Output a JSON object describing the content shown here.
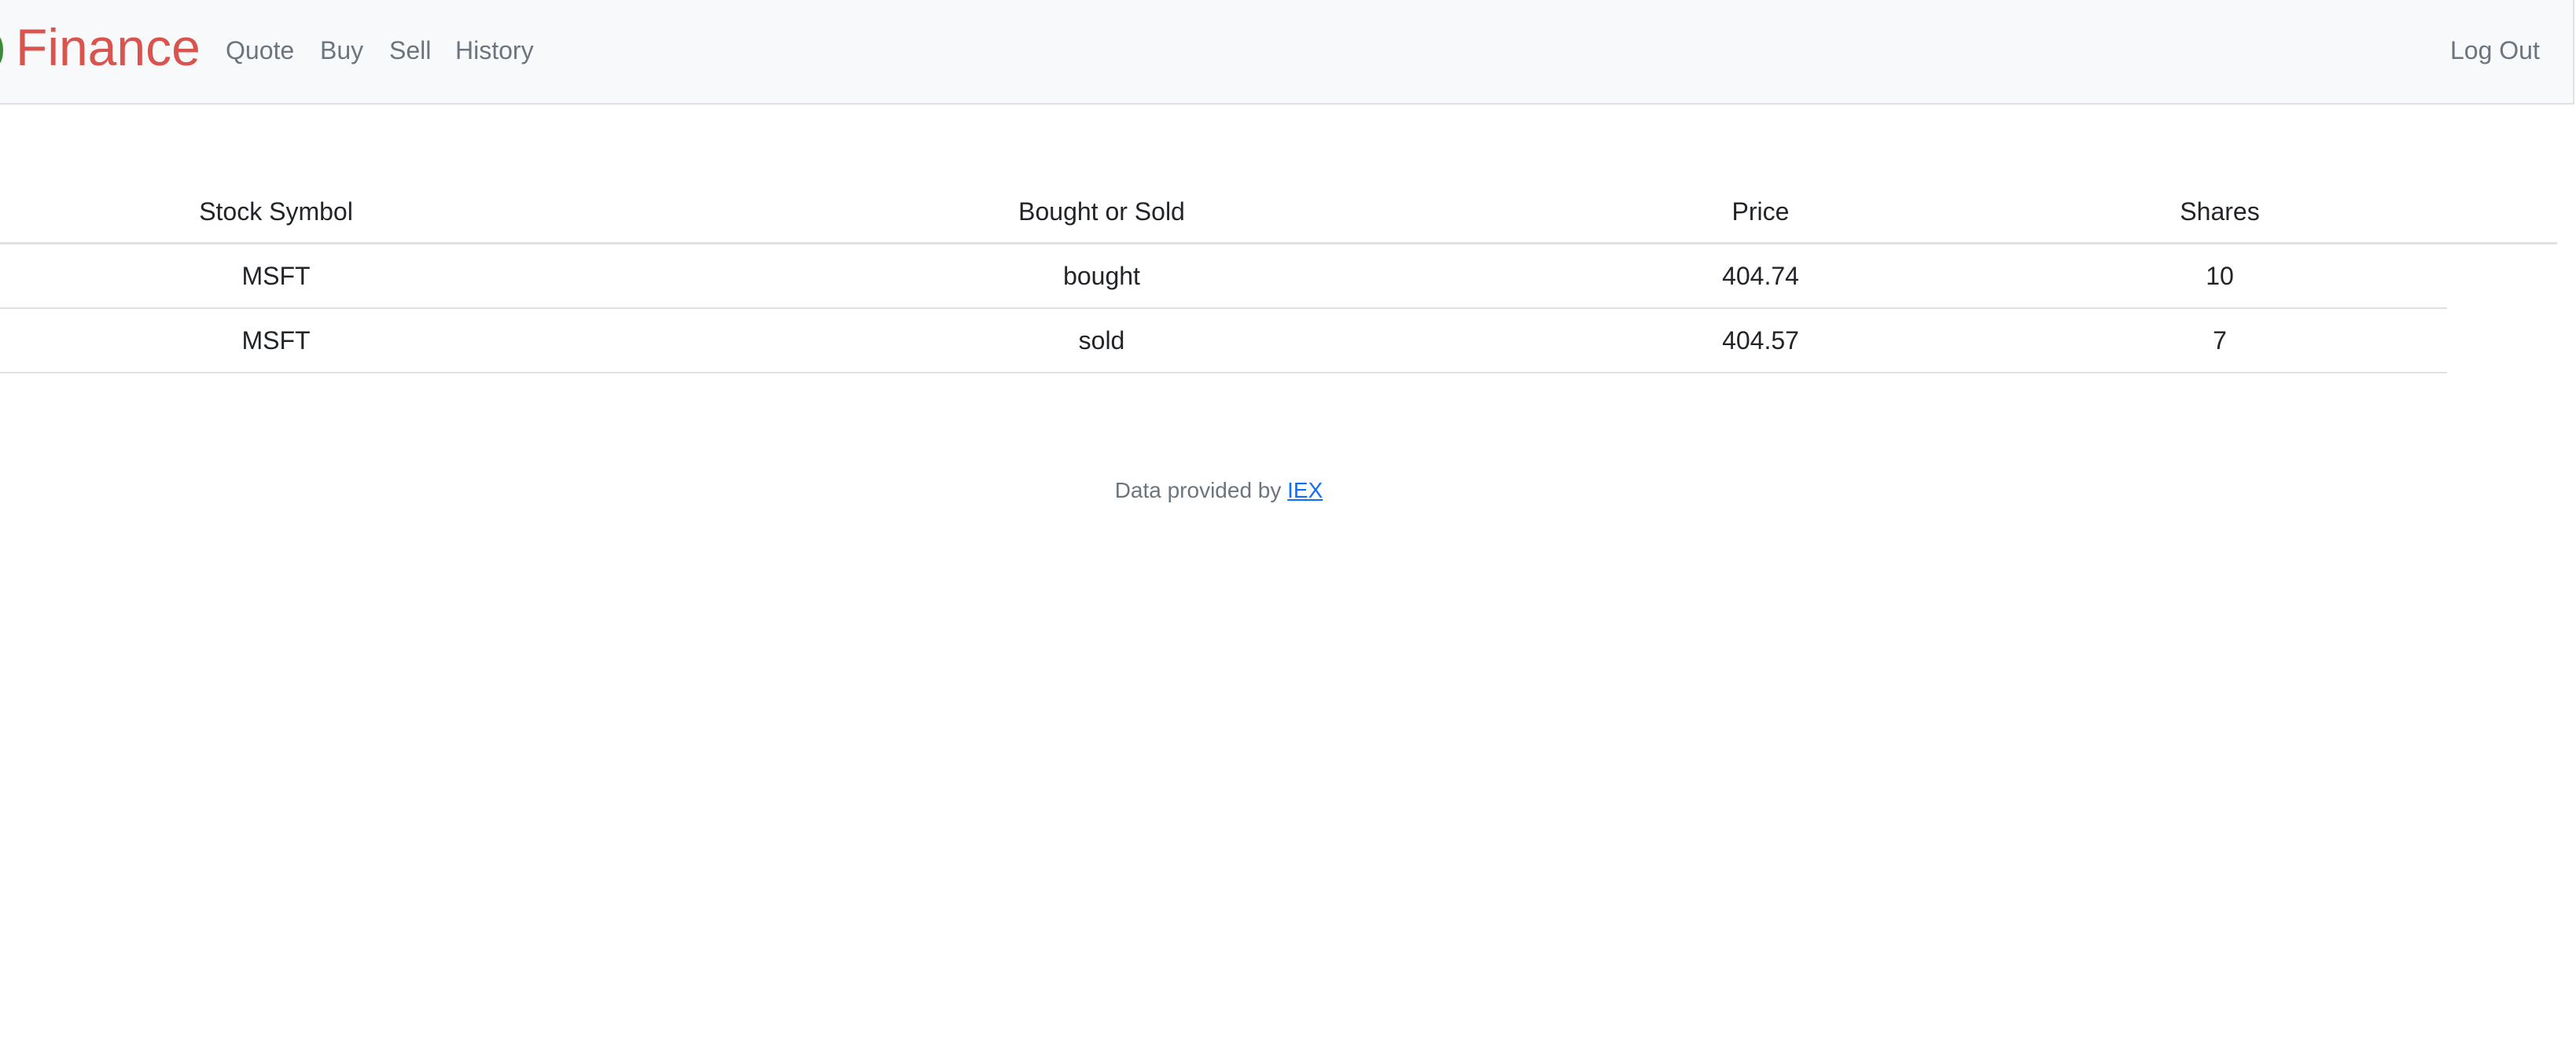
{
  "navbar": {
    "brand": "Finance",
    "links": {
      "quote": "Quote",
      "buy": "Buy",
      "sell": "Sell",
      "history": "History"
    },
    "logout": "Log Out",
    "colors": {
      "brand": "#d9534f",
      "background": "#f8f9fa",
      "link": "#6c757d"
    }
  },
  "history_table": {
    "headers": [
      "Stock Symbol",
      "Bought or Sold",
      "Price",
      "Shares"
    ],
    "rows": [
      [
        "MSFT",
        "bought",
        "404.74",
        "10"
      ],
      [
        "MSFT",
        "sold",
        "404.57",
        "7"
      ]
    ]
  },
  "footer": {
    "text": "Data provided by",
    "link_text": "IEX",
    "link_color": "#0d6efd"
  }
}
